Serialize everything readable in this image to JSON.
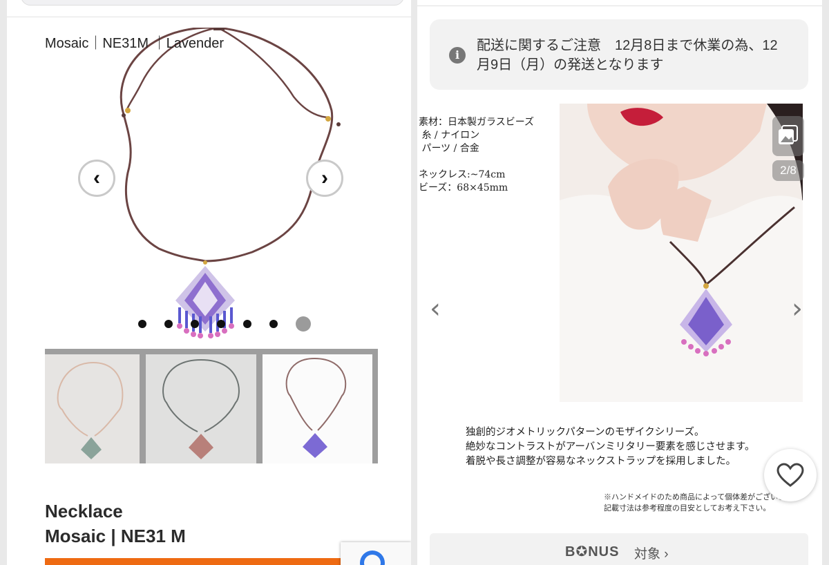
{
  "left": {
    "breadcrumb": "Mosaic｜NE31M ｜Lavender",
    "nav": {
      "prev": "‹",
      "next": "›"
    },
    "carousel": {
      "dot_count": 7,
      "active_index": 6
    },
    "product_title_line1": "Necklace",
    "product_title_line2": "Mosaic | NE31 M"
  },
  "right": {
    "notice": "配送に関するご注意　12月8日まで休業の為、12月9日（月）の発送となります",
    "info_icon": "i",
    "specs": "素材：日本製ガラスビーズ\n 糸 / ナイロン\n パーツ / 合金\n\nネックレス:~74cm\nビーズ：68×45mm",
    "gallery_counter": "2/8",
    "description": "独創的ジオメトリックパターンのモザイクシリーズ。\n絶妙なコントラストがアーバンミリタリー要素を感じさせます。\n着脱や長さ調整が容易なネックストラップを採用しました。",
    "footnote": "※ハンドメイドのため商品によって個体差がございます。\n記載寸法は参考程度の目安としてお考え下さい。",
    "bonus_label": "B✪NUS",
    "bonus_text": "対象 ›"
  },
  "colors": {
    "accent": "#ee6a12",
    "cord": "#5a3b3a",
    "bead_purple": "#6c5bd0",
    "bead_pink": "#d26bbd"
  }
}
